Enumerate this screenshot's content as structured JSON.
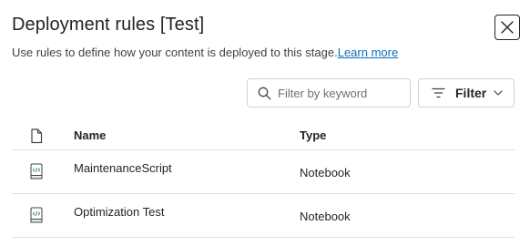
{
  "panel": {
    "title": "Deployment rules [Test]",
    "subtitle": "Use rules to define how your content is deployed to this stage.",
    "learn_more": "Learn more",
    "close_icon": "close-icon"
  },
  "toolbar": {
    "search_placeholder": "Filter by keyword",
    "search_value": "",
    "search_icon": "search-icon",
    "filter_label": "Filter",
    "filter_icon": "filter-icon",
    "chevron_icon": "chevron-down-icon"
  },
  "table": {
    "header_icon": "document-icon",
    "columns": [
      "Name",
      "Type"
    ],
    "rows": [
      {
        "icon": "notebook-icon",
        "name": "MaintenanceScript",
        "type": "Notebook"
      },
      {
        "icon": "notebook-icon",
        "name": "Optimization Test",
        "type": "Notebook"
      }
    ]
  },
  "colors": {
    "link": "#0f6cbd",
    "notebook_icon": "#2f8f62",
    "border": "#d1d1d1",
    "divider": "#e0e0e0",
    "text": "#242424"
  }
}
